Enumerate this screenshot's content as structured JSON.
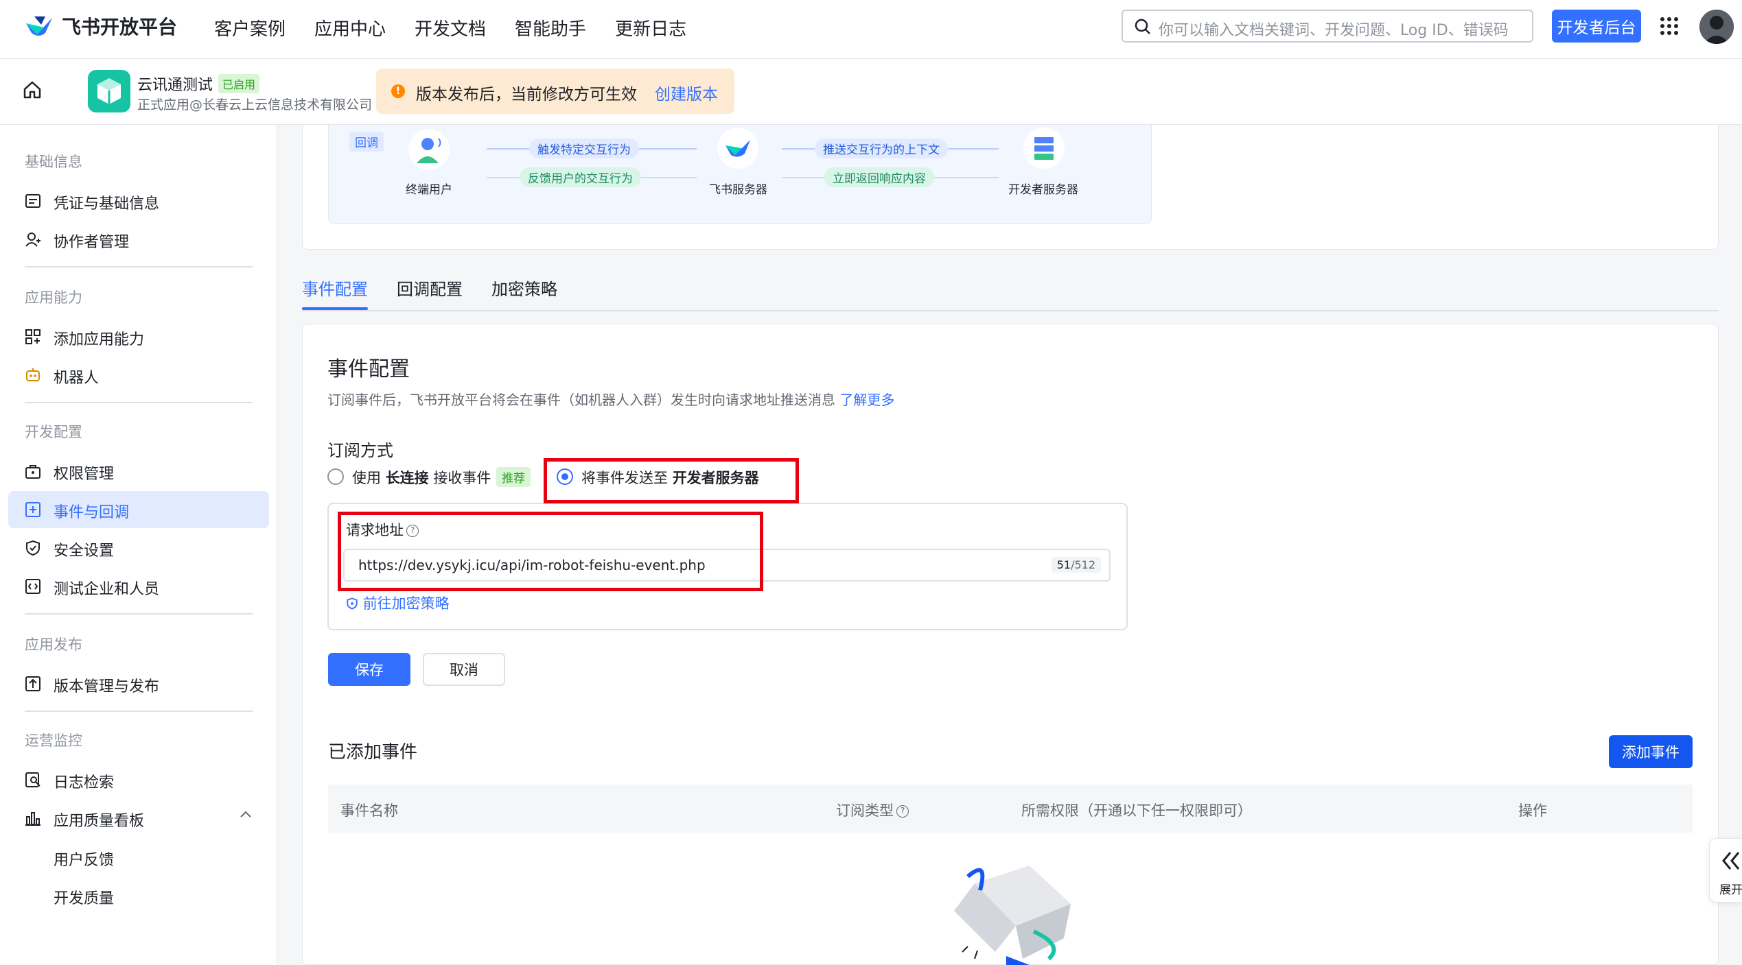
{
  "topnav": {
    "logo_text": "飞书开放平台",
    "items": [
      "客户案例",
      "应用中心",
      "开发文档",
      "智能助手",
      "更新日志"
    ],
    "search_placeholder": "你可以输入文档关键词、开发问题、Log ID、错误码",
    "dev_button": "开发者后台"
  },
  "app": {
    "name": "云讯通测试",
    "status_badge": "已启用",
    "org": "正式应用@长春云上云信息技术有限公司",
    "notice_text": "版本发布后，当前修改方可生效",
    "notice_link": "创建版本",
    "notice_icon": "!"
  },
  "sidebar": {
    "groups": [
      {
        "label": "基础信息",
        "items": [
          {
            "label": "凭证与基础信息",
            "icon": "credential-icon"
          },
          {
            "label": "协作者管理",
            "icon": "collaborator-icon"
          }
        ]
      },
      {
        "label": "应用能力",
        "items": [
          {
            "label": "添加应用能力",
            "icon": "add-capability-icon"
          },
          {
            "label": "机器人",
            "icon": "robot-icon"
          }
        ]
      },
      {
        "label": "开发配置",
        "items": [
          {
            "label": "权限管理",
            "icon": "permission-icon"
          },
          {
            "label": "事件与回调",
            "icon": "event-icon"
          },
          {
            "label": "安全设置",
            "icon": "shield-icon"
          },
          {
            "label": "测试企业和人员",
            "icon": "test-icon"
          }
        ]
      },
      {
        "label": "应用发布",
        "items": [
          {
            "label": "版本管理与发布",
            "icon": "publish-icon"
          }
        ]
      },
      {
        "label": "运营监控",
        "items": [
          {
            "label": "日志检索",
            "icon": "log-icon"
          },
          {
            "label": "应用质量看板",
            "icon": "chart-icon"
          }
        ]
      }
    ],
    "subitems": [
      "用户反馈",
      "开发质量"
    ],
    "active": "事件与回调"
  },
  "diagram": {
    "tag": "回调",
    "nodes": [
      "终端用户",
      "飞书服务器",
      "开发者服务器"
    ],
    "arrows": [
      "触发特定交互行为",
      "反馈用户的交互行为",
      "推送交互行为的上下文",
      "立即返回响应内容"
    ]
  },
  "tabs": [
    "事件配置",
    "回调配置",
    "加密策略"
  ],
  "event_config": {
    "title": "事件配置",
    "description": "订阅事件后，飞书开放平台将会在事件（如机器人入群）发生时向请求地址推送消息",
    "learn_more": "了解更多",
    "subscribe_label": "订阅方式",
    "option1_pre": "使用",
    "option1_bold": "长连接",
    "option1_post": "接收事件",
    "option1_badge": "推荐",
    "option2_pre": "将事件发送至",
    "option2_bold": "开发者服务器",
    "url_label": "请求地址",
    "help_icon": "?",
    "url_value": "https://dev.ysykj.icu/api/im-robot-feishu-event.php",
    "url_count": "51",
    "url_max": "/512",
    "encryption_link": "前往加密策略",
    "save_label": "保存",
    "cancel_label": "取消"
  },
  "added_events": {
    "title": "已添加事件",
    "add_button": "添加事件",
    "columns": [
      "事件名称",
      "订阅类型",
      "所需权限（开通以下任一权限即可）",
      "操作"
    ]
  },
  "expand_label": "展开",
  "colors": {
    "brand": "#3370ff",
    "annotation": "#e60012",
    "success": "#2ea121",
    "warning": "#ff8800"
  }
}
